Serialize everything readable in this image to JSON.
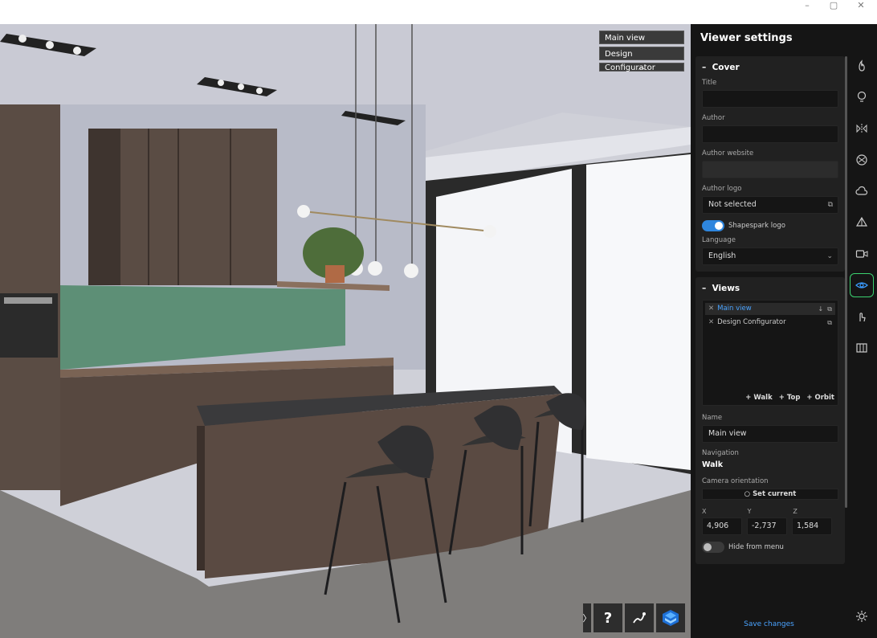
{
  "window": {
    "minimize_icon": "minimize-icon",
    "maximize_icon": "maximize-icon",
    "close_icon": "close-icon"
  },
  "viewport": {
    "views_menu": [
      "Main view",
      "Design Configurator"
    ],
    "collapse_symbol": "︿",
    "toolbar": {
      "expand_symbol": "〉",
      "help_label": "?",
      "path_icon": "path-icon",
      "logo_icon": "shapespark-logo-icon"
    }
  },
  "panel": {
    "title": "Viewer settings",
    "cover": {
      "heading": "Cover",
      "title_label": "Title",
      "title_value": "",
      "author_label": "Author",
      "author_value": "",
      "website_label": "Author website",
      "website_value": "",
      "logo_label": "Author logo",
      "logo_value": "Not selected",
      "shapespark_logo_label": "Shapespark logo",
      "language_label": "Language",
      "language_value": "English"
    },
    "views": {
      "heading": "Views",
      "items": [
        "Main view",
        "Design Configurator"
      ],
      "add_walk": "Walk",
      "add_top": "Top",
      "add_orbit": "Orbit",
      "name_label": "Name",
      "name_value": "Main view",
      "navigation_label": "Navigation",
      "navigation_value": "Walk",
      "camera_label": "Camera orientation",
      "set_current": "Set current",
      "x_label": "X",
      "y_label": "Y",
      "z_label": "Z",
      "x_value": "4,906",
      "y_value": "-2,737",
      "z_value": "1,584",
      "hide_label": "Hide from menu"
    },
    "save_label": "Save changes"
  },
  "iconbar": [
    "bake-icon",
    "light-icon",
    "mirror-icon",
    "material-icon",
    "sky-icon",
    "prism-icon",
    "video-icon",
    "eye-icon",
    "touch-icon",
    "book-icon",
    "settings-icon"
  ],
  "colors": {
    "accent": "#2e86de",
    "link": "#4aa3ff",
    "active_outline": "#3bd16f",
    "panel_bg": "#151515"
  }
}
